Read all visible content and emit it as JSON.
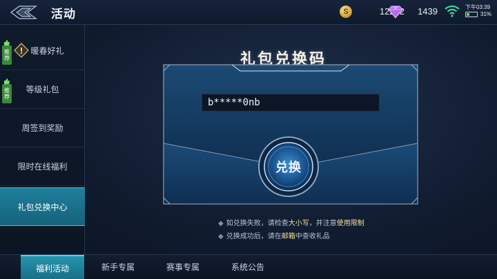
{
  "header": {
    "title": "活动",
    "coins": "12212",
    "coin_symbol": "S",
    "gems": "1439",
    "time": "下午03:39",
    "battery": "31%",
    "battery_level": 0.31
  },
  "sidebar": {
    "items": [
      {
        "label": "暖春好礼",
        "badge": "推荐"
      },
      {
        "label": "等级礼包",
        "badge": "推荐"
      },
      {
        "label": "周签到奖励"
      },
      {
        "label": "限时在线福利"
      },
      {
        "label": "礼包兑换中心"
      }
    ],
    "alert_symbol": "!"
  },
  "main": {
    "title": "礼包兑换码",
    "code_value": "b*****0nb",
    "redeem_label": "兑换",
    "tips": [
      {
        "prefix": "如兑换失败，请检查",
        "hl1": "大小写",
        "mid": "，并注意",
        "hl2": "使用限制",
        "suffix": ""
      },
      {
        "prefix": "兑换成功后，请在",
        "hl1": "邮箱",
        "mid": "中查收礼品",
        "hl2": "",
        "suffix": ""
      }
    ],
    "bullet": "◆"
  },
  "tabs": [
    {
      "label": "福利活动"
    },
    {
      "label": "新手专属"
    },
    {
      "label": "赛事专属"
    },
    {
      "label": "系统公告"
    }
  ],
  "colors": {
    "accent": "#2794ad",
    "highlight": "#f3e09a",
    "badge_green": "#3a8a3a"
  },
  "icons": [
    "back-icon",
    "coin-icon",
    "gem-icon",
    "wifi-icon",
    "battery-icon",
    "thumbs-up-icon",
    "alert-icon"
  ]
}
